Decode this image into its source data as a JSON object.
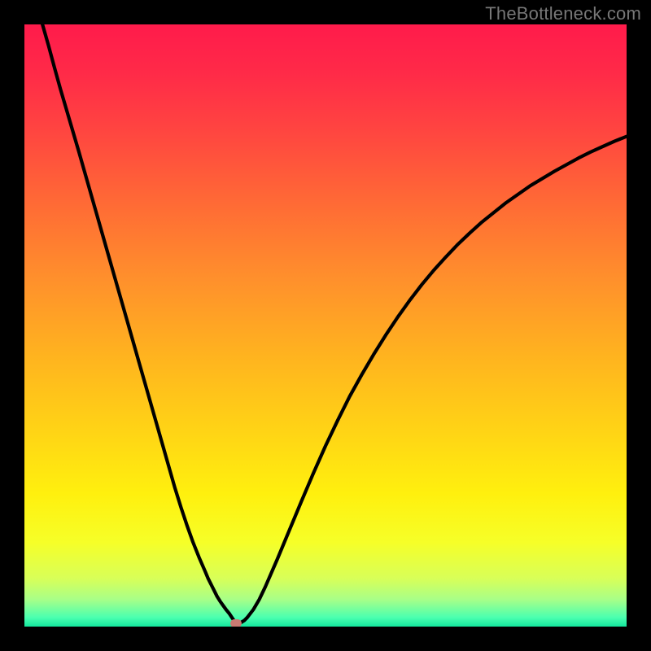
{
  "watermark": "TheBottleneck.com",
  "gradient_stops": [
    {
      "offset": 0.0,
      "color": "#ff1b4b"
    },
    {
      "offset": 0.08,
      "color": "#ff2a48"
    },
    {
      "offset": 0.18,
      "color": "#ff4640"
    },
    {
      "offset": 0.3,
      "color": "#ff6b35"
    },
    {
      "offset": 0.42,
      "color": "#ff8f2c"
    },
    {
      "offset": 0.55,
      "color": "#ffb31f"
    },
    {
      "offset": 0.68,
      "color": "#ffd515"
    },
    {
      "offset": 0.78,
      "color": "#fff00e"
    },
    {
      "offset": 0.86,
      "color": "#f6ff28"
    },
    {
      "offset": 0.92,
      "color": "#d8ff58"
    },
    {
      "offset": 0.955,
      "color": "#a8ff88"
    },
    {
      "offset": 0.985,
      "color": "#4affb0"
    },
    {
      "offset": 1.0,
      "color": "#14e79d"
    }
  ],
  "chart_data": {
    "type": "line",
    "title": "",
    "xlabel": "",
    "ylabel": "",
    "xlim": [
      0,
      1
    ],
    "ylim": [
      0,
      1
    ],
    "grid": false,
    "legend": false,
    "x": [
      0.0,
      0.01,
      0.02,
      0.03,
      0.04,
      0.05,
      0.06,
      0.07,
      0.08,
      0.09,
      0.1,
      0.11,
      0.12,
      0.13,
      0.14,
      0.15,
      0.16,
      0.17,
      0.18,
      0.19,
      0.2,
      0.21,
      0.22,
      0.23,
      0.24,
      0.25,
      0.26,
      0.27,
      0.28,
      0.29,
      0.3,
      0.305,
      0.31,
      0.315,
      0.32,
      0.325,
      0.33,
      0.335,
      0.34,
      0.342,
      0.344,
      0.346,
      0.348,
      0.35,
      0.352,
      0.354,
      0.356,
      0.358,
      0.36,
      0.365,
      0.37,
      0.38,
      0.39,
      0.4,
      0.42,
      0.44,
      0.46,
      0.48,
      0.5,
      0.52,
      0.54,
      0.56,
      0.58,
      0.6,
      0.62,
      0.64,
      0.66,
      0.68,
      0.7,
      0.72,
      0.74,
      0.76,
      0.78,
      0.8,
      0.82,
      0.84,
      0.86,
      0.88,
      0.9,
      0.92,
      0.94,
      0.96,
      0.98,
      1.0
    ],
    "y": [
      1.09,
      1.06,
      1.03,
      1.0,
      0.965,
      0.928,
      0.892,
      0.858,
      0.824,
      0.79,
      0.755,
      0.72,
      0.685,
      0.65,
      0.615,
      0.58,
      0.545,
      0.51,
      0.475,
      0.44,
      0.405,
      0.37,
      0.335,
      0.3,
      0.265,
      0.23,
      0.198,
      0.168,
      0.14,
      0.115,
      0.092,
      0.08,
      0.07,
      0.06,
      0.05,
      0.042,
      0.035,
      0.028,
      0.022,
      0.019,
      0.016,
      0.013,
      0.01,
      0.008,
      0.007,
      0.006,
      0.006,
      0.006,
      0.007,
      0.01,
      0.015,
      0.028,
      0.045,
      0.066,
      0.112,
      0.16,
      0.208,
      0.255,
      0.3,
      0.342,
      0.382,
      0.418,
      0.452,
      0.484,
      0.514,
      0.542,
      0.568,
      0.592,
      0.614,
      0.635,
      0.654,
      0.672,
      0.688,
      0.704,
      0.718,
      0.732,
      0.744,
      0.756,
      0.767,
      0.778,
      0.788,
      0.797,
      0.806,
      0.814
    ],
    "marker": {
      "x": 0.352,
      "y": 0.005
    },
    "annotations": []
  }
}
